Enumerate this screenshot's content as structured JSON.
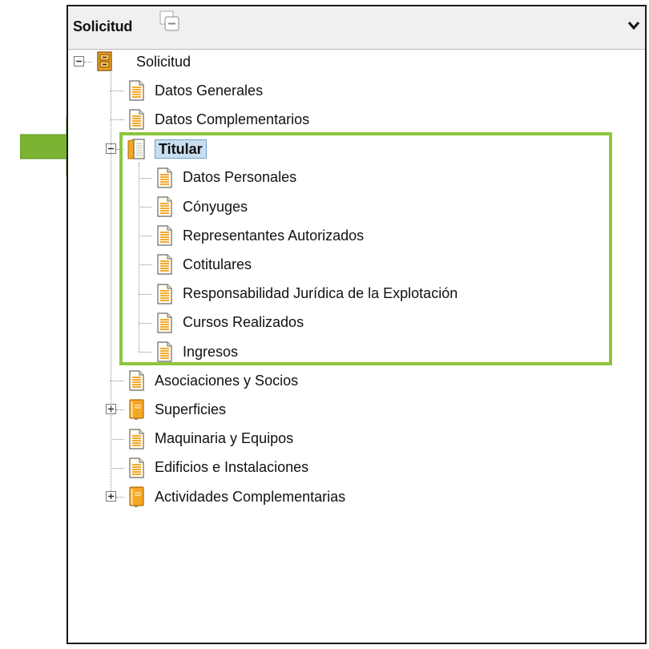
{
  "panel": {
    "title": "Solicitud",
    "icons": {
      "collapse": "collapse-all-icon",
      "menu": "chevron-down-icon"
    }
  },
  "tree": {
    "root": {
      "label": "Solicitud",
      "icon": "cabinet-icon",
      "expanded": true
    },
    "items": [
      {
        "label": "Datos Generales",
        "icon": "document-icon"
      },
      {
        "label": "Datos Complementarios",
        "icon": "document-icon"
      },
      {
        "label": "Titular",
        "icon": "open-book-icon",
        "expanded": true,
        "selected": true,
        "children": [
          {
            "label": "Datos Personales",
            "icon": "document-icon"
          },
          {
            "label": "Cónyuges",
            "icon": "document-icon"
          },
          {
            "label": "Representantes Autorizados",
            "icon": "document-icon"
          },
          {
            "label": "Cotitulares",
            "icon": "document-icon"
          },
          {
            "label": "Responsabilidad Jurídica de la Explotación",
            "icon": "document-icon"
          },
          {
            "label": "Cursos Realizados",
            "icon": "document-icon"
          },
          {
            "label": "Ingresos",
            "icon": "document-icon"
          }
        ]
      },
      {
        "label": "Asociaciones y Socios",
        "icon": "document-icon"
      },
      {
        "label": "Superficies",
        "icon": "closed-book-icon",
        "expanded": false
      },
      {
        "label": "Maquinaria y Equipos",
        "icon": "document-icon"
      },
      {
        "label": "Edificios e Instalaciones",
        "icon": "document-icon"
      },
      {
        "label": "Actividades Complementarias",
        "icon": "closed-book-icon",
        "expanded": false
      }
    ]
  },
  "annotation": {
    "highlight_color": "#8cc63f",
    "arrow_color": "#7ab432",
    "selection_color": "#c8def0"
  }
}
